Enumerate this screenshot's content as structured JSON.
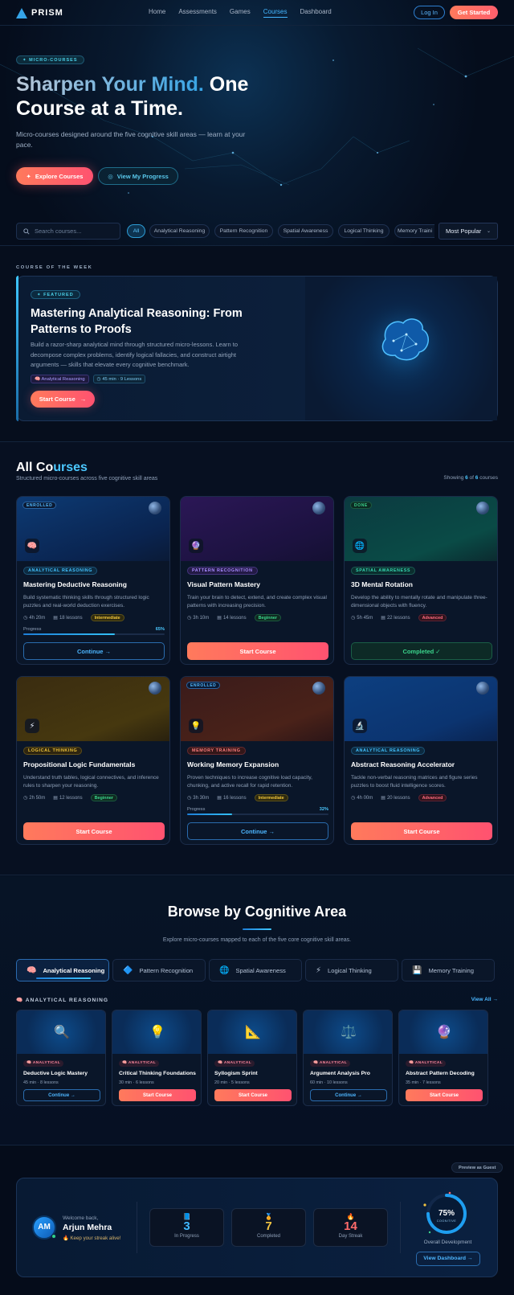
{
  "nav": {
    "brand": "PRISM",
    "links": [
      "Home",
      "Assessments",
      "Games",
      "Courses",
      "Dashboard"
    ],
    "login": "Log In",
    "get_started": "Get Started"
  },
  "hero": {
    "badge": "✦ MICRO-COURSES",
    "title_accent": "Sharpen Your Mind.",
    "title_rest": " One Course at a Time.",
    "subtitle": "Micro-courses designed around the five cognitive skill areas — learn at your pace.",
    "btn_explore": "Explore Courses",
    "btn_progress": "View My Progress"
  },
  "filters": {
    "search_placeholder": "Search courses...",
    "chips": [
      "All",
      "Analytical Reasoning",
      "Pattern Recognition",
      "Spatial Awareness",
      "Logical Thinking",
      "Memory Traini"
    ],
    "sort": "Most Popular"
  },
  "featured": {
    "section_label": "COURSE OF THE WEEK",
    "badge": "✦ FEATURED",
    "title": "Mastering Analytical Reasoning: From Patterns to Proofs",
    "description": "Build a razor-sharp analytical mind through structured micro-lessons. Learn to decompose complex problems, identify logical fallacies, and construct airtight arguments — skills that elevate every cognitive benchmark.",
    "tag_area": "Analytical Reasoning",
    "tag_meta": "45 min · 9 Lessons",
    "btn": "Start Course"
  },
  "all_courses": {
    "title_a": "All Co",
    "title_b": "urses",
    "subtitle": "Structured micro-courses across five cognitive skill areas",
    "showing_pre": "Showing ",
    "showing_n": "6",
    "showing_of": " of ",
    "showing_total": "6",
    "showing_post": " courses",
    "progress_label": "Progress",
    "cards": [
      {
        "status": "ENROLLED",
        "icon": "🧠",
        "category": "ANALYTICAL REASONING",
        "title": "Mastering Deductive Reasoning",
        "desc": "Build systematic thinking skills through structured logic puzzles and real-world deduction exercises.",
        "time": "4h 20m",
        "lessons": "18 lessons",
        "level": "Intermediate",
        "progress": "65%",
        "btn": "Continue →"
      },
      {
        "status": "",
        "icon": "🔮",
        "category": "PATTERN RECOGNITION",
        "title": "Visual Pattern Mastery",
        "desc": "Train your brain to detect, extend, and create complex visual patterns with increasing precision.",
        "time": "3h 10m",
        "lessons": "14 lessons",
        "level": "Beginner",
        "progress": "",
        "btn": "Start Course"
      },
      {
        "status": "DONE",
        "icon": "🌐",
        "category": "SPATIAL AWARENESS",
        "title": "3D Mental Rotation",
        "desc": "Develop the ability to mentally rotate and manipulate three-dimensional objects with fluency.",
        "time": "5h 45m",
        "lessons": "22 lessons",
        "level": "Advanced",
        "progress": "",
        "btn": "Completed ✓"
      },
      {
        "status": "",
        "icon": "⚡",
        "category": "LOGICAL THINKING",
        "title": "Propositional Logic Fundamentals",
        "desc": "Understand truth tables, logical connectives, and inference rules to sharpen your reasoning.",
        "time": "2h 50m",
        "lessons": "12 lessons",
        "level": "Beginner",
        "progress": "",
        "btn": "Start Course"
      },
      {
        "status": "ENROLLED",
        "icon": "💡",
        "category": "MEMORY TRAINING",
        "title": "Working Memory Expansion",
        "desc": "Proven techniques to increase cognitive load capacity, chunking, and active recall for rapid retention.",
        "time": "3h 30m",
        "lessons": "16 lessons",
        "level": "Intermediate",
        "progress": "32%",
        "btn": "Continue →"
      },
      {
        "status": "",
        "icon": "🔬",
        "category": "ANALYTICAL REASONING",
        "title": "Abstract Reasoning Accelerator",
        "desc": "Tackle non-verbal reasoning matrices and figure series puzzles to boost fluid intelligence scores.",
        "time": "4h 00m",
        "lessons": "20 lessons",
        "level": "Advanced",
        "progress": "",
        "btn": "Start Course"
      }
    ]
  },
  "browse": {
    "title": "Browse by Cognitive Area",
    "subtitle": "Explore micro-courses mapped to each of the five core cognitive skill areas.",
    "tabs": [
      {
        "icon": "🧠",
        "label": "Analytical Reasoning"
      },
      {
        "icon": "🔷",
        "label": "Pattern Recognition"
      },
      {
        "icon": "🌐",
        "label": "Spatial Awareness"
      },
      {
        "icon": "⚡",
        "label": "Logical Thinking"
      },
      {
        "icon": "💾",
        "label": "Memory Training"
      }
    ],
    "area_heading": "🧠 ANALYTICAL REASONING",
    "view_all": "View All →",
    "mini_tag": "🧠 ANALYTICAL",
    "items": [
      {
        "icon": "🔍",
        "title": "Deductive Logic Mastery",
        "meta": "45 min · 8 lessons",
        "btn": "Continue →"
      },
      {
        "icon": "💡",
        "title": "Critical Thinking Foundations",
        "meta": "30 min · 6 lessons",
        "btn": "Start Course"
      },
      {
        "icon": "📐",
        "title": "Syllogism Sprint",
        "meta": "20 min · 5 lessons",
        "btn": "Start Course"
      },
      {
        "icon": "⚖️",
        "title": "Argument Analysis Pro",
        "meta": "60 min · 10 lessons",
        "btn": "Continue →"
      },
      {
        "icon": "🔮",
        "title": "Abstract Pattern Decoding",
        "meta": "35 min · 7 lessons",
        "btn": "Start Course"
      }
    ]
  },
  "dashboard": {
    "preview": "Preview as Guest",
    "avatar": "AM",
    "welcome": "Welcome back,",
    "name": "Arjun Mehra",
    "streak": "🔥 Keep your streak alive!",
    "stats": [
      {
        "icon": "📘",
        "value": "3",
        "label": "In Progress",
        "color": "#3fb7ff"
      },
      {
        "icon": "🏅",
        "value": "7",
        "label": "Completed",
        "color": "#f4c542"
      },
      {
        "icon": "🔥",
        "value": "14",
        "label": "Day Streak",
        "color": "#ff6b6b"
      }
    ],
    "ring_value": "75%",
    "ring_fraction": 0.75,
    "ring_label": "COGNITIVE",
    "overall": "Overall Development",
    "btn": "View Dashboard →"
  }
}
